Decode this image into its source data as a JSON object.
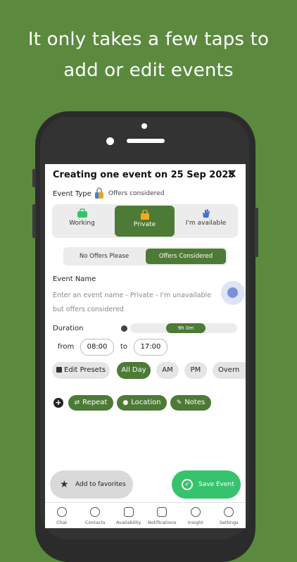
{
  "headline": {
    "line1": "It only takes a few taps to",
    "line2": "add or edit events"
  },
  "dialog": {
    "title": "Creating one event on 25 Sep 2025",
    "close": "✕",
    "event_type_label": "Event Type",
    "event_type_value": "Offers considered",
    "type_options": [
      {
        "label": "Working",
        "icon": "briefcase-icon",
        "selected": false
      },
      {
        "label": "Private",
        "icon": "lock-icon",
        "selected": true
      },
      {
        "label": "I'm available",
        "icon": "hand-icon",
        "selected": false
      }
    ],
    "offer_options": [
      {
        "label": "No Offers Please",
        "selected": false
      },
      {
        "label": "Offers Considered",
        "selected": true
      }
    ],
    "event_name_label": "Event Name",
    "event_name_placeholder": "Enter an event name - Private - I'm unavailable but offers considered",
    "duration_label": "Duration",
    "duration_value": "9h 0m",
    "from_label": "from",
    "from_time": "08:00",
    "to_label": "to",
    "to_time": "17:00",
    "presets": [
      {
        "label": "Edit Presets",
        "icon": "edit-icon",
        "selected": false
      },
      {
        "label": "All Day",
        "selected": true
      },
      {
        "label": "AM",
        "selected": false
      },
      {
        "label": "PM",
        "selected": false
      },
      {
        "label": "Overn",
        "selected": false
      }
    ],
    "actions": [
      {
        "label": "Repeat",
        "icon": "repeat-icon"
      },
      {
        "label": "Location",
        "icon": "location-pin-icon"
      },
      {
        "label": "Notes",
        "icon": "pencil-icon"
      }
    ],
    "add_favorites": "Add to favorites",
    "save_event": "Save Event"
  },
  "tabs": [
    "Chat",
    "Contacts",
    "Availability",
    "Notifications",
    "Insight",
    "Settings"
  ],
  "colors": {
    "background": "#5b8a3f",
    "accent": "#4d7a35",
    "save": "#35c46d"
  }
}
